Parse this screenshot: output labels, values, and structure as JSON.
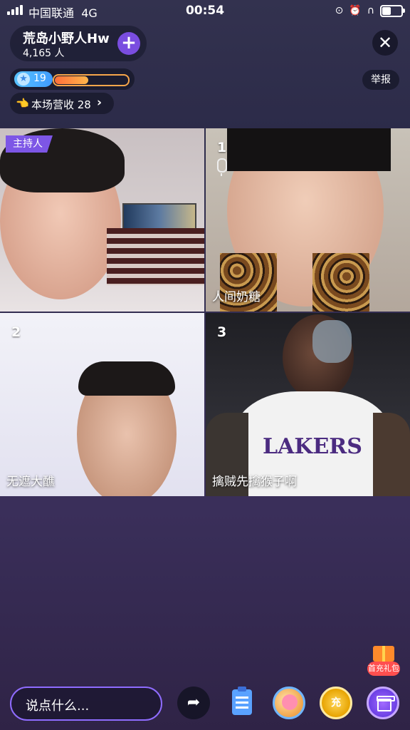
{
  "status_bar": {
    "carrier": "中国联通",
    "network": "4G",
    "time": "00:54",
    "battery_level": 0.5
  },
  "room": {
    "name": "荒岛小野人Hw",
    "viewer_count": "4,165 人",
    "follow_symbol": "+",
    "close_symbol": "✕",
    "level": "19",
    "level_progress": 0.45,
    "report_label": "举报",
    "revenue_label": "本场营收 28",
    "revenue_chevron": "›"
  },
  "seats": [
    {
      "badge": "主持人",
      "number": "",
      "name": "",
      "has_mic_icon": false
    },
    {
      "badge": "",
      "number": "1",
      "name": "人间奶糖",
      "has_mic_icon": true
    },
    {
      "badge": "",
      "number": "2",
      "name": "无遮大醮",
      "has_mic_icon": false
    },
    {
      "badge": "",
      "number": "3",
      "name": "擒贼先擒猴子啊",
      "has_mic_icon": false
    }
  ],
  "bottom_bar": {
    "chat_placeholder": "说点什么...",
    "recharge_label": "充",
    "first_recharge_label": "首充礼包",
    "icons": [
      "share-icon",
      "task-list-icon",
      "game-icon",
      "coin-recharge-icon",
      "gift-icon",
      "first-recharge-gift-icon"
    ]
  },
  "colors": {
    "accent": "#7d56e6",
    "chat_border": "#8f6cff",
    "level_badge": "#3f9bff",
    "progress": "#ff8a3d"
  }
}
